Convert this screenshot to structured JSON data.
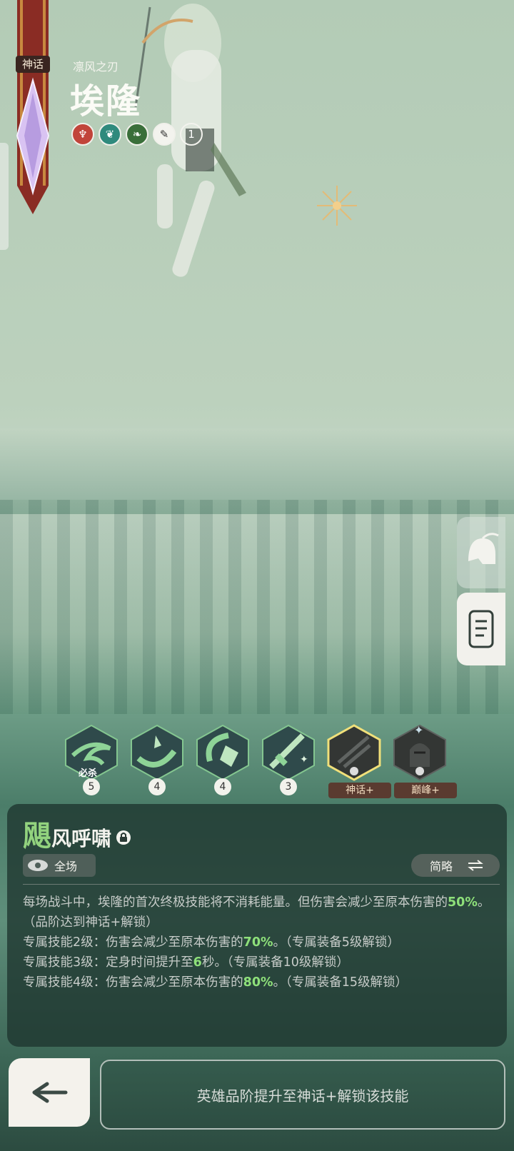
{
  "hero": {
    "rarity": "神话",
    "subtitle": "凛风之刃",
    "name": "埃隆",
    "tags": [
      "trident-icon",
      "spirit-icon",
      "leaf-icon",
      "feather-icon"
    ],
    "tag_count": "1"
  },
  "skills": [
    {
      "level": "5",
      "label": "必杀",
      "icon": "whirlwind-icon",
      "locked": false
    },
    {
      "level": "4",
      "label": "",
      "icon": "axe-slash-icon",
      "locked": false
    },
    {
      "level": "4",
      "label": "",
      "icon": "crescent-slash-icon",
      "locked": false
    },
    {
      "level": "3",
      "label": "",
      "icon": "sword-sparkle-icon",
      "locked": false
    },
    {
      "level": "",
      "label": "神话+",
      "icon": "wind-slash-icon",
      "locked": true
    },
    {
      "level": "",
      "label": "巅峰+",
      "icon": "knight-helmet-icon",
      "locked": true
    }
  ],
  "panel": {
    "title_first": "飓",
    "title_rest": "风呼啸",
    "range_label": "全场",
    "mode_label": "简略",
    "desc": {
      "line1": "每场战斗中，埃隆的首次终极技能将不消耗能量。但伤害会减少至原本伤害的",
      "line1_value": "50%",
      "line1_tail": "。（品阶达到神话+解锁）",
      "line2": "专属技能2级：伤害会减少至原本伤害的",
      "line2_value": "70%",
      "line2_tail": "。（专属装备5级解锁）",
      "line3": "专属技能3级：定身时间提升至",
      "line3_value": "6",
      "line3_tail": "秒。（专属装备10级解锁）",
      "line4": "专属技能4级：伤害会减少至原本伤害的",
      "line4_value": "80%",
      "line4_tail": "。（专属装备15级解锁）"
    }
  },
  "footer": {
    "unlock_text": "英雄品阶提升至神话+解锁该技能"
  },
  "colors": {
    "highlight": "#8ee07a",
    "panel_bg": "#1e342e",
    "lock_badge": "#5a3b30"
  }
}
